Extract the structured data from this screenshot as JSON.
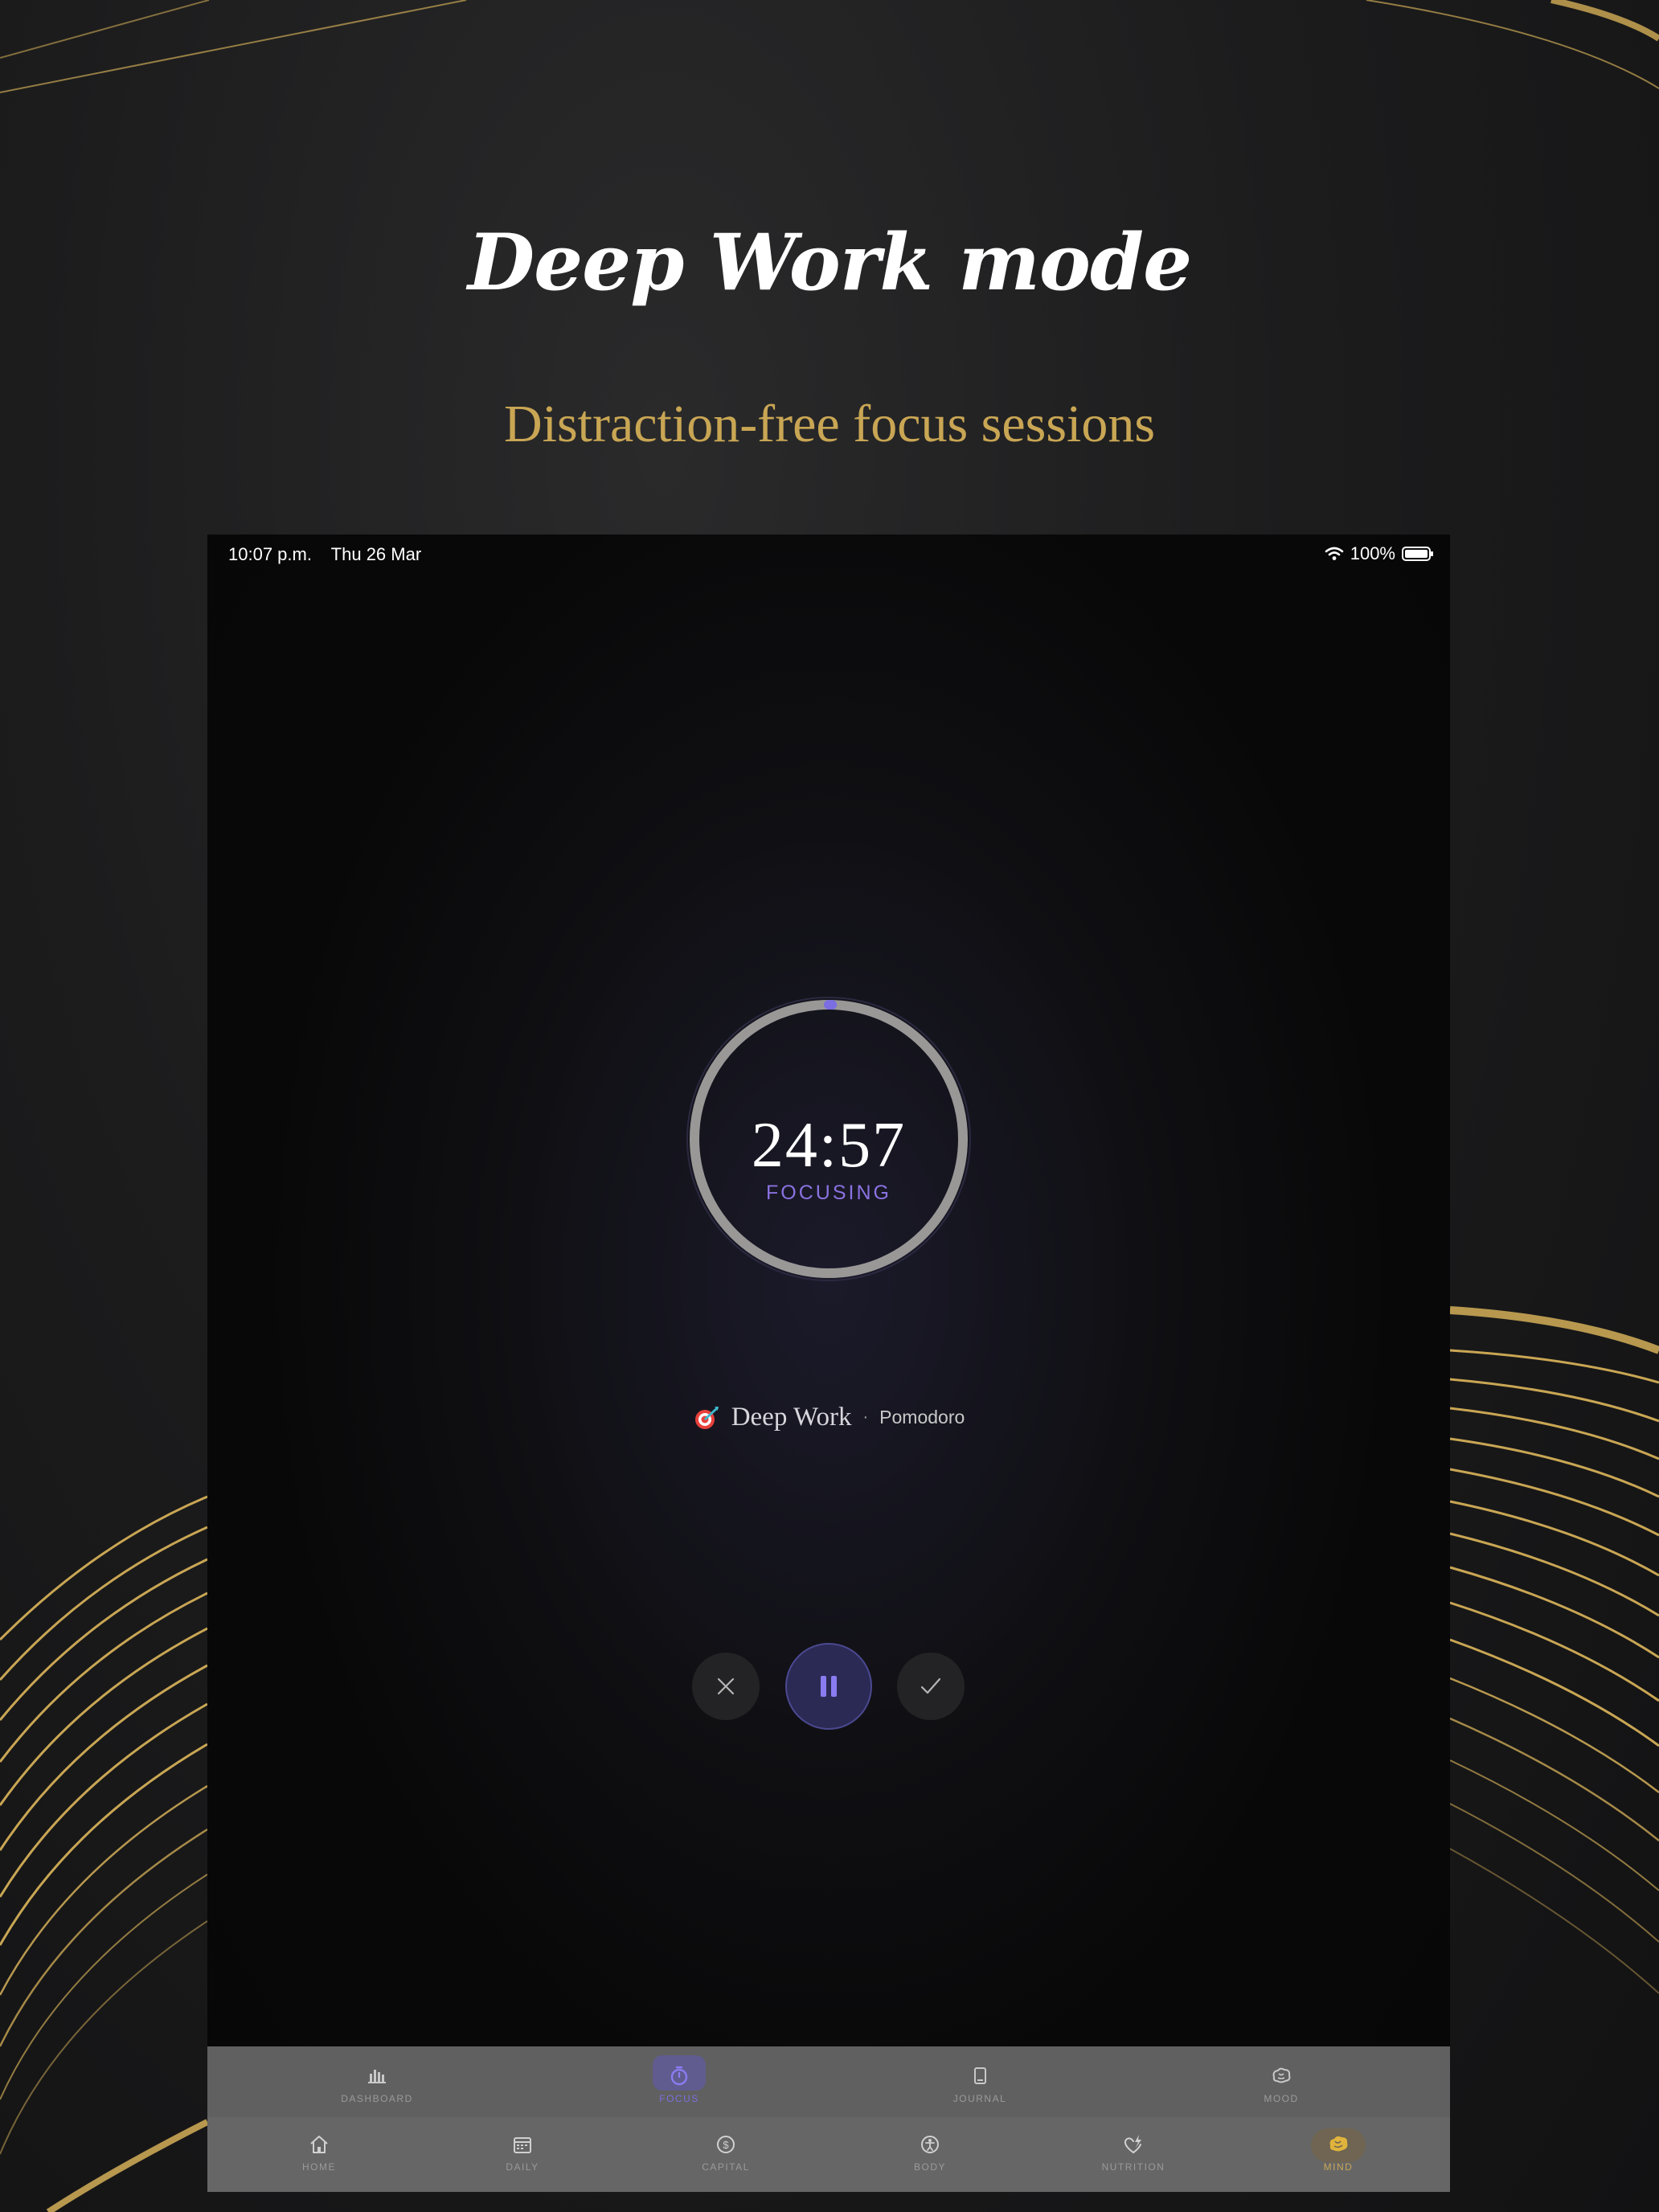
{
  "promo": {
    "headline": "Deep Work mode",
    "subheadline": "Distraction-free focus sessions"
  },
  "status_bar": {
    "time": "10:07 p.m.",
    "date": "Thu 26 Mar",
    "battery": "100%",
    "wifi_icon": "wifi-icon",
    "battery_icon": "battery-icon"
  },
  "session": {
    "icon": "target-icon",
    "name": "Deep Work",
    "separator": "·",
    "mode": "Pomodoro",
    "time_remaining": "24:57",
    "state": "FOCUSING",
    "progress_fraction": 0.002
  },
  "controls": {
    "cancel_icon": "close-icon",
    "pause_icon": "pause-icon",
    "complete_icon": "checkmark-icon"
  },
  "tabs_primary": [
    {
      "label": "DASHBOARD",
      "icon": "bar-chart-icon"
    },
    {
      "label": "FOCUS",
      "icon": "timer-icon",
      "active": true
    },
    {
      "label": "JOURNAL",
      "icon": "book-icon"
    },
    {
      "label": "MOOD",
      "icon": "brain-outline-icon"
    }
  ],
  "tabs_secondary": [
    {
      "label": "HOME",
      "icon": "home-icon"
    },
    {
      "label": "DAILY",
      "icon": "calendar-icon"
    },
    {
      "label": "CAPITAL",
      "icon": "dollar-icon"
    },
    {
      "label": "BODY",
      "icon": "body-icon"
    },
    {
      "label": "NUTRITION",
      "icon": "heart-bolt-icon"
    },
    {
      "label": "MIND",
      "icon": "brain-icon",
      "active": true
    }
  ],
  "colors": {
    "accent_purple": "#8a72e0",
    "accent_gold": "#c9a654",
    "background": "#1c1c1d"
  }
}
